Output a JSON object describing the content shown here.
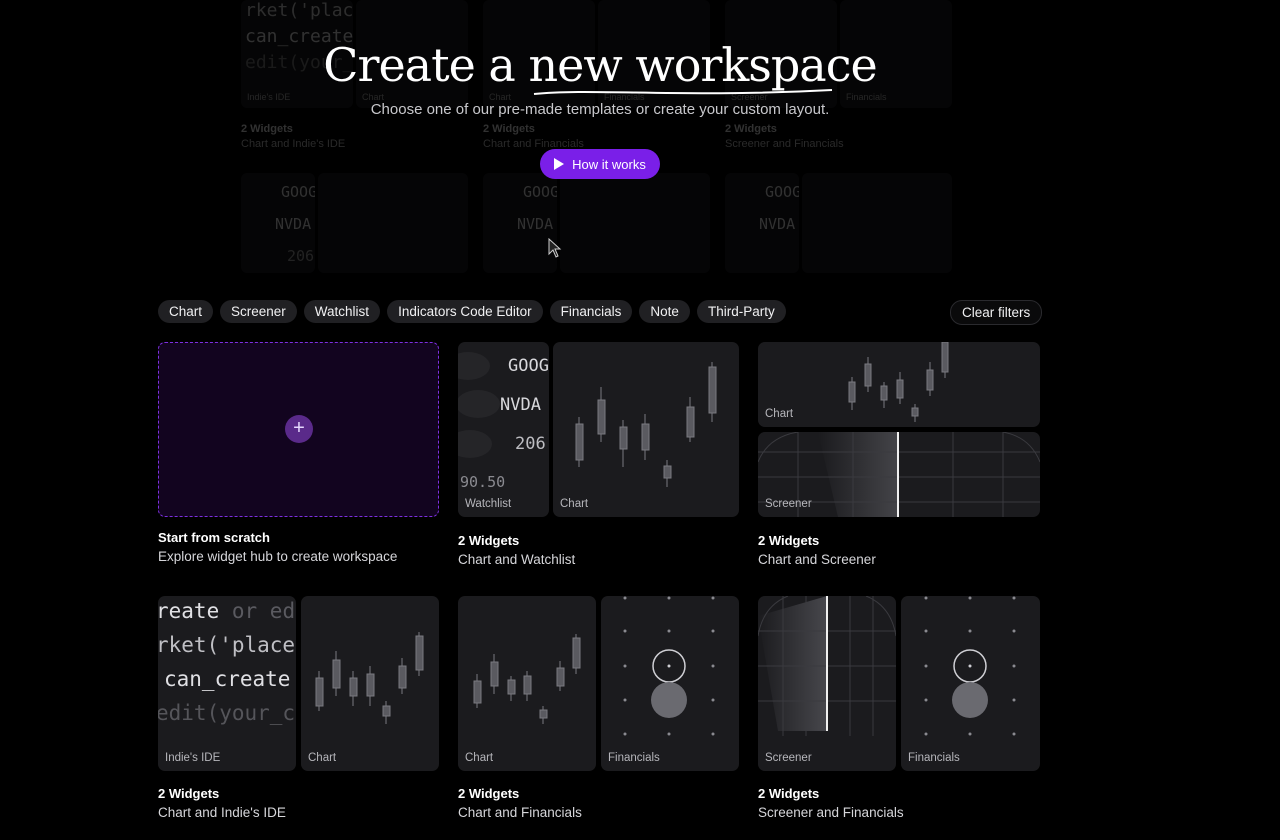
{
  "hero": {
    "title": "Create a new workspace",
    "subtitle": "Choose one of our pre-made templates or create your custom layout.",
    "how_label": "How it works"
  },
  "background": {
    "cards": [
      {
        "labels": [
          "Indie's IDE",
          "Chart"
        ],
        "title": "2 Widgets",
        "subtitle": "Chart and Indie's IDE"
      },
      {
        "labels": [
          "Chart",
          "Financials"
        ],
        "title": "2 Widgets",
        "subtitle": "Chart and Financials"
      },
      {
        "labels": [
          "Screener",
          "Financials"
        ],
        "title": "2 Widgets",
        "subtitle": "Screener and Financials"
      }
    ],
    "code_lines": [
      "rket('place",
      "can_create",
      "edit(your_c"
    ],
    "tickers": [
      "GOOG",
      "NVDA",
      "206."
    ]
  },
  "filters": {
    "chips": [
      "Chart",
      "Screener",
      "Watchlist",
      "Indicators Code Editor",
      "Financials",
      "Note",
      "Third-Party"
    ],
    "clear": "Clear filters"
  },
  "scratch": {
    "title": "Start from scratch",
    "subtitle": "Explore widget hub to create workspace",
    "plus": "+"
  },
  "templates": [
    {
      "title": "2 Widgets",
      "subtitle": "Chart and Watchlist",
      "labels": [
        "Watchlist",
        "Chart"
      ]
    },
    {
      "title": "2 Widgets",
      "subtitle": "Chart and Screener",
      "labels": [
        "Chart",
        "Screener"
      ]
    },
    {
      "title": "2 Widgets",
      "subtitle": "Chart and Indie's IDE",
      "labels": [
        "Indie's IDE",
        "Chart"
      ]
    },
    {
      "title": "2 Widgets",
      "subtitle": "Chart and Financials",
      "labels": [
        "Chart",
        "Financials"
      ]
    },
    {
      "title": "2 Widgets",
      "subtitle": "Screener and Financials",
      "labels": [
        "Screener",
        "Financials"
      ]
    }
  ],
  "watchlist": {
    "tickers": [
      "GOOG",
      "NVDA",
      "206.",
      "90.50"
    ]
  },
  "ide": {
    "lines": [
      "reate",
      "or ed",
      "rket('place",
      "can_create",
      "edit(your_c"
    ]
  },
  "colors": {
    "accent": "#7a1fe8",
    "scratch_border": "#7d2fe0",
    "pane": "#1b1b1e"
  }
}
